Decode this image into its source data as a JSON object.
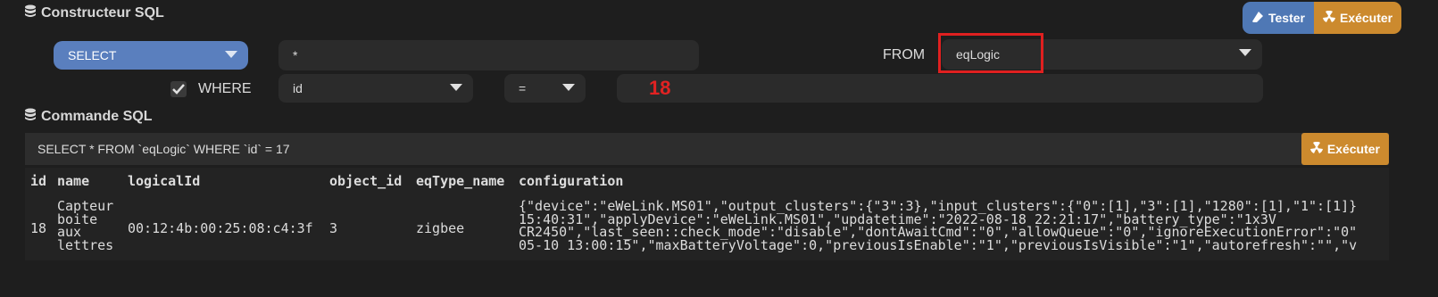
{
  "builder": {
    "title": "Constructeur SQL",
    "tester_label": "Tester",
    "execute_label": "Exécuter",
    "select_value": "SELECT",
    "fields_value": "*",
    "from_label": "FROM",
    "from_value": "eqLogic",
    "where_label": "WHERE",
    "where_checked": true,
    "where_column": "id",
    "where_operator": "=",
    "where_value": "18"
  },
  "command": {
    "title": "Commande SQL",
    "query": "SELECT * FROM `eqLogic` WHERE `id` = 17",
    "execute_label": "Exécuter"
  },
  "results": {
    "columns": [
      "id",
      "name",
      "logicalId",
      "object_id",
      "eqType_name",
      "configuration"
    ],
    "rows": [
      {
        "id": "18",
        "name": "Capteur\nboite\naux\nlettres",
        "logicalId": "00:12:4b:00:25:08:c4:3f",
        "object_id": "3",
        "eqType_name": "zigbee",
        "configuration": "{\"device\":\"eWeLink.MS01\",\"output_clusters\":{\"3\":3},\"input_clusters\":{\"0\":[1],\"3\":[1],\"1280\":[1],\"1\":[1]}\n15:40:31\",\"applyDevice\":\"eWeLink.MS01\",\"updatetime\":\"2022-08-18 22:21:17\",\"battery_type\":\"1x3V\nCR2450\",\"last_seen::check_mode\":\"disable\",\"dontAwaitCmd\":\"0\",\"allowQueue\":\"0\",\"ignoreExecutionError\":\"0\"\n05-10 13:00:15\",\"maxBatteryVoltage\":0,\"previousIsEnable\":\"1\",\"previousIsVisible\":\"1\",\"autorefresh\":\"\",\"v"
      }
    ]
  },
  "colors": {
    "accent_blue": "#5a7fbe",
    "accent_orange": "#cc8a2e",
    "highlight_red": "#e02020"
  }
}
